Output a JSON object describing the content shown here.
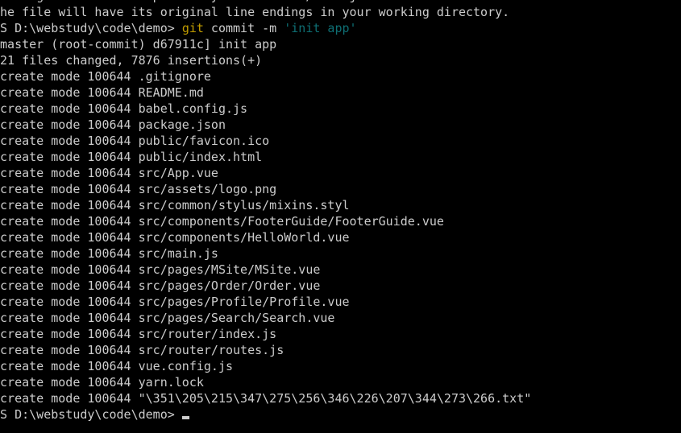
{
  "terminal": {
    "shell": "PowerShell",
    "background_color": "#000000",
    "foreground_color": "#cccccc",
    "accent_colors": {
      "command_keyword": "#c19c00",
      "string_literal": "#0e6f74"
    },
    "prompt": "PS D:\\webstudy\\code\\demo>",
    "working_directory": "D:\\webstudy\\code\\demo",
    "cursor": {
      "shape": "underline",
      "visible": true
    },
    "lines": [
      {
        "id": "warning-crlf",
        "segments": [
          {
            "text": "warning: LF will be replaced by CRLF in src/main.js.",
            "color": "default"
          }
        ]
      },
      {
        "id": "warning-crlf-cont",
        "segments": [
          {
            "text": "The file will have its original line endings in your working directory.",
            "color": "default"
          }
        ]
      },
      {
        "id": "prompt-commit",
        "segments": [
          {
            "text": "PS D:\\webstudy\\code\\demo> ",
            "color": "default"
          },
          {
            "text": "git",
            "color": "yellow"
          },
          {
            "text": " commit -m ",
            "color": "default"
          },
          {
            "text": "'init app'",
            "color": "teal"
          }
        ]
      },
      {
        "id": "commit-summary",
        "segments": [
          {
            "text": "[master (root-commit) d67911c] init app",
            "color": "default"
          }
        ]
      },
      {
        "id": "commit-stats",
        "segments": [
          {
            "text": " 21 files changed, 7876 insertions(+)",
            "color": "default"
          }
        ]
      },
      {
        "id": "file-gitignore",
        "segments": [
          {
            "text": " create mode 100644 .gitignore",
            "color": "default"
          }
        ]
      },
      {
        "id": "file-readme",
        "segments": [
          {
            "text": " create mode 100644 README.md",
            "color": "default"
          }
        ]
      },
      {
        "id": "file-babel-config",
        "segments": [
          {
            "text": " create mode 100644 babel.config.js",
            "color": "default"
          }
        ]
      },
      {
        "id": "file-package-json",
        "segments": [
          {
            "text": " create mode 100644 package.json",
            "color": "default"
          }
        ]
      },
      {
        "id": "file-favicon",
        "segments": [
          {
            "text": " create mode 100644 public/favicon.ico",
            "color": "default"
          }
        ]
      },
      {
        "id": "file-index-html",
        "segments": [
          {
            "text": " create mode 100644 public/index.html",
            "color": "default"
          }
        ]
      },
      {
        "id": "file-app-vue",
        "segments": [
          {
            "text": " create mode 100644 src/App.vue",
            "color": "default"
          }
        ]
      },
      {
        "id": "file-logo-png",
        "segments": [
          {
            "text": " create mode 100644 src/assets/logo.png",
            "color": "default"
          }
        ]
      },
      {
        "id": "file-mixins-styl",
        "segments": [
          {
            "text": " create mode 100644 src/common/stylus/mixins.styl",
            "color": "default"
          }
        ]
      },
      {
        "id": "file-footerguide-vue",
        "segments": [
          {
            "text": " create mode 100644 src/components/FooterGuide/FooterGuide.vue",
            "color": "default"
          }
        ]
      },
      {
        "id": "file-helloworld-vue",
        "segments": [
          {
            "text": " create mode 100644 src/components/HelloWorld.vue",
            "color": "default"
          }
        ]
      },
      {
        "id": "file-main-js",
        "segments": [
          {
            "text": " create mode 100644 src/main.js",
            "color": "default"
          }
        ]
      },
      {
        "id": "file-msite-vue",
        "segments": [
          {
            "text": " create mode 100644 src/pages/MSite/MSite.vue",
            "color": "default"
          }
        ]
      },
      {
        "id": "file-order-vue",
        "segments": [
          {
            "text": " create mode 100644 src/pages/Order/Order.vue",
            "color": "default"
          }
        ]
      },
      {
        "id": "file-profile-vue",
        "segments": [
          {
            "text": " create mode 100644 src/pages/Profile/Profile.vue",
            "color": "default"
          }
        ]
      },
      {
        "id": "file-search-vue",
        "segments": [
          {
            "text": " create mode 100644 src/pages/Search/Search.vue",
            "color": "default"
          }
        ]
      },
      {
        "id": "file-router-index-js",
        "segments": [
          {
            "text": " create mode 100644 src/router/index.js",
            "color": "default"
          }
        ]
      },
      {
        "id": "file-router-routes-js",
        "segments": [
          {
            "text": " create mode 100644 src/router/routes.js",
            "color": "default"
          }
        ]
      },
      {
        "id": "file-vue-config-js",
        "segments": [
          {
            "text": " create mode 100644 vue.config.js",
            "color": "default"
          }
        ]
      },
      {
        "id": "file-yarn-lock",
        "segments": [
          {
            "text": " create mode 100644 yarn.lock",
            "color": "default"
          }
        ]
      },
      {
        "id": "file-escaped-chinese-txt",
        "segments": [
          {
            "text": " create mode 100644 \"\\351\\205\\215\\347\\275\\256\\346\\226\\207\\344\\273\\266.txt\"",
            "color": "default"
          }
        ]
      },
      {
        "id": "prompt-final",
        "segments": [
          {
            "text": "PS D:\\webstudy\\code\\demo>",
            "color": "default"
          }
        ],
        "cursor": true
      }
    ]
  }
}
